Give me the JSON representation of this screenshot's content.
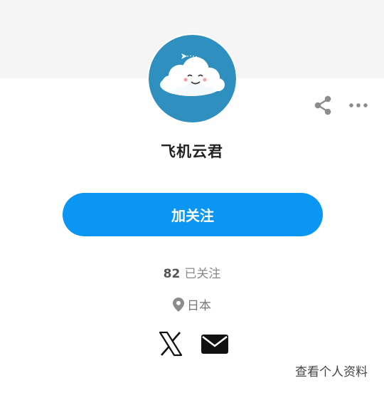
{
  "profile": {
    "name": "飞机云君",
    "follow_label": "加关注",
    "following_count": "82",
    "following_label": "已关注",
    "location": "日本",
    "view_profile_label": "查看个人资料"
  },
  "icons": {
    "share": "share-icon",
    "more": "more-horizontal-icon",
    "location": "location-pin-icon",
    "x": "x-twitter-icon",
    "mail": "mail-icon"
  },
  "colors": {
    "accent": "#0a96f2",
    "banner": "#f5f5f5",
    "avatar_bg": "#2f8fbf"
  }
}
